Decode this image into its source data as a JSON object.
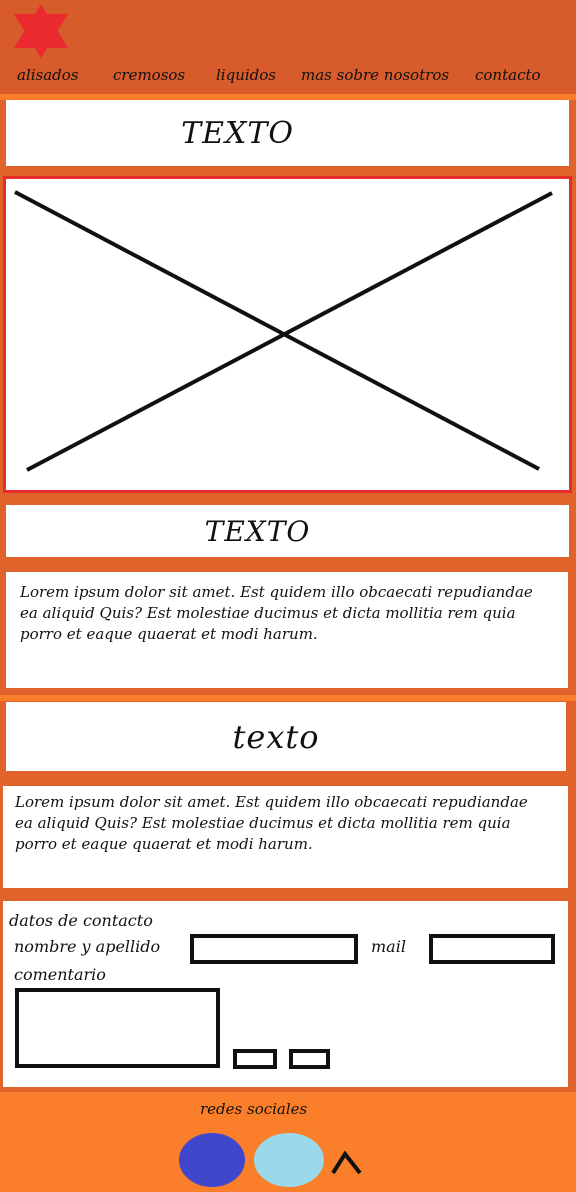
{
  "nav": {
    "items": [
      "alisados",
      "cremosos",
      "liquidos",
      "mas sobre nosotros",
      "contacto"
    ]
  },
  "sections": {
    "title1": "TEXTO",
    "title2": "TEXTO",
    "para1": "Lorem ipsum dolor sit amet. Est quidem illo obcaecati repudiandae ea aliquid Quis? Est molestiae ducimus et dicta mollitia rem quia porro et eaque quaerat et modi harum.",
    "title3": "texto",
    "para2": "Lorem ipsum dolor sit amet. Est quidem illo obcaecati repudiandae ea aliquid Quis? Est molestiae ducimus et dicta mollitia rem quia porro et eaque quaerat et modi harum."
  },
  "contact": {
    "heading": "datos de contacto",
    "name_label": "nombre y apellido",
    "mail_label": "mail",
    "comment_label": "comentario"
  },
  "footer": {
    "social_label": "redes sociales",
    "icons": [
      "social-icon-blue",
      "social-icon-lightblue",
      "caret-up-icon"
    ]
  },
  "colors": {
    "header_bg": "#d85b2c",
    "page_bg": "#e0632c",
    "strip_bg": "#fb7f2b",
    "logo_red": "#ea2a2f",
    "image_border": "#e72b2b",
    "social_blue": "#3f48cc",
    "social_lightblue": "#99d9ea"
  }
}
